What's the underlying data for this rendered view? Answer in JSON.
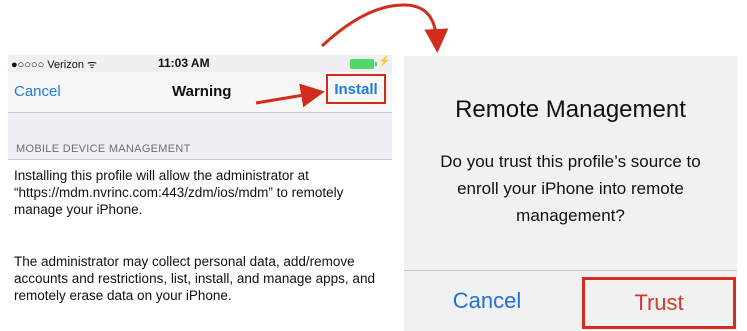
{
  "phone": {
    "status_bar": {
      "carrier": "●○○○○ Verizon ᯤ",
      "time": "11:03 AM",
      "charge_glyph": "⚡"
    },
    "nav": {
      "cancel_label": "Cancel",
      "title": "Warning",
      "install_label": "Install"
    },
    "section_header": "MOBILE DEVICE MANAGEMENT",
    "paragraph1": "Installing this profile will allow the administrator at “https://mdm.nvrinc.com:443/zdm/ios/mdm” to remotely manage your iPhone.",
    "paragraph2": "The administrator may collect personal data, add/remove accounts and restrictions, list, install, and manage apps, and remotely erase data on your iPhone."
  },
  "dialog": {
    "title": "Remote Management",
    "message": "Do you trust this profile’s source to enroll your iPhone into remote management?",
    "cancel_label": "Cancel",
    "trust_label": "Trust"
  },
  "colors": {
    "ios_blue": "#1f7cdb",
    "annotation_red": "#d32c1c",
    "battery_green": "#4cd964"
  },
  "icons": {
    "wifi": "wifi-icon",
    "battery": "battery-icon",
    "charging": "charging-icon",
    "arrow": "red-arrow-icon"
  }
}
